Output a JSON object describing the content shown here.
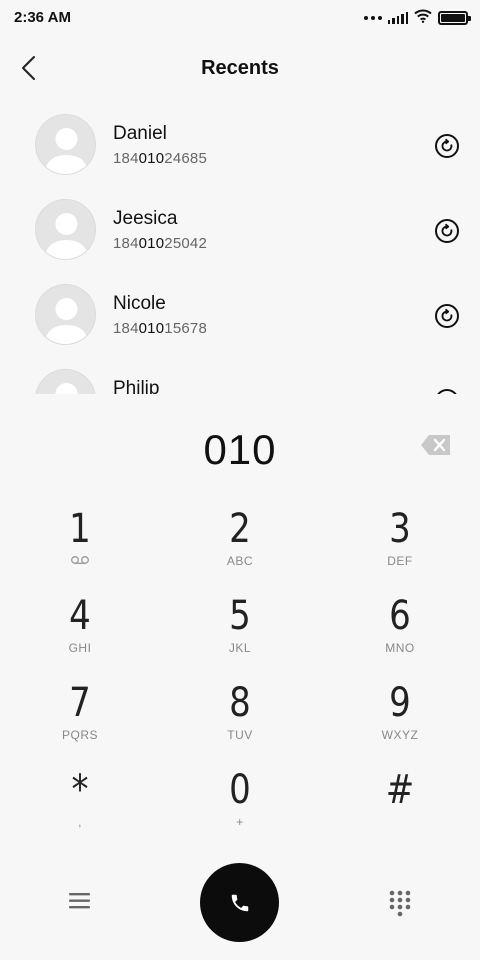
{
  "status_bar": {
    "time": "2:36 AM",
    "icons": [
      "more-dots-icon",
      "signal-icon",
      "wifi-icon",
      "battery-icon"
    ]
  },
  "header": {
    "title": "Recents",
    "back_icon": "chevron-left-icon"
  },
  "contacts": [
    {
      "name": "Daniel",
      "number_prefix": "184",
      "number_match": "010",
      "number_suffix": "24685",
      "action_icon": "redial-icon"
    },
    {
      "name": "Jeesica",
      "number_prefix": "184",
      "number_match": "010",
      "number_suffix": "25042",
      "action_icon": "redial-icon"
    },
    {
      "name": "Nicole",
      "number_prefix": "184",
      "number_match": "010",
      "number_suffix": "15678",
      "action_icon": "redial-icon"
    },
    {
      "name": "Philip",
      "number_prefix": "",
      "number_match": "",
      "number_suffix": "",
      "action_icon": "redial-icon"
    }
  ],
  "dial": {
    "number": "010",
    "backspace_icon": "backspace-icon"
  },
  "keypad": [
    {
      "digit": "1",
      "letters": "",
      "sub_icon": "voicemail-icon"
    },
    {
      "digit": "2",
      "letters": "ABC"
    },
    {
      "digit": "3",
      "letters": "DEF"
    },
    {
      "digit": "4",
      "letters": "GHI"
    },
    {
      "digit": "5",
      "letters": "JKL"
    },
    {
      "digit": "6",
      "letters": "MNO"
    },
    {
      "digit": "7",
      "letters": "PQRS"
    },
    {
      "digit": "8",
      "letters": "TUV"
    },
    {
      "digit": "9",
      "letters": "WXYZ"
    },
    {
      "digit": "*",
      "letters": ","
    },
    {
      "digit": "0",
      "letters": "+"
    },
    {
      "digit": "#",
      "letters": ""
    }
  ],
  "bottom_bar": {
    "menu_icon": "menu-icon",
    "call_icon": "phone-icon",
    "keypad_icon": "dialpad-icon"
  },
  "colors": {
    "background": "#f7f7f7",
    "call_button": "#0c0c0c",
    "text_primary": "#111111",
    "text_secondary": "#666666"
  }
}
